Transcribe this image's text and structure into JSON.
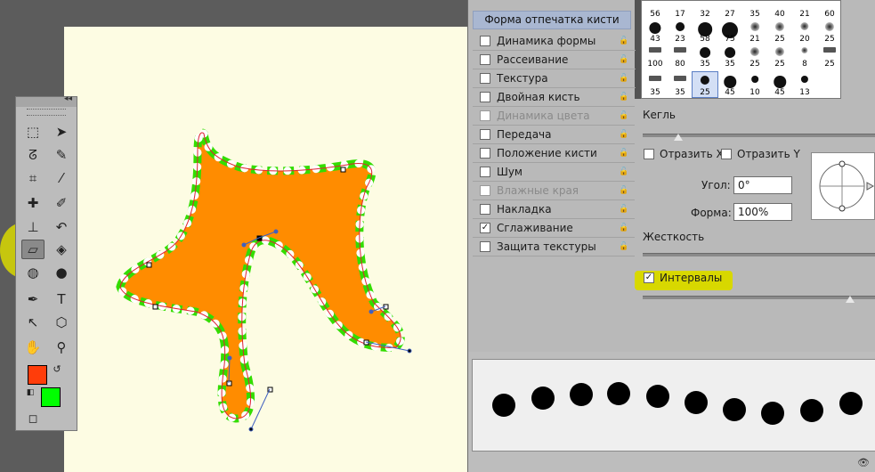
{
  "brush_panel": {
    "title": "Форма отпечатка кисти",
    "options": [
      {
        "label": "Динамика формы",
        "checked": false,
        "enabled": true
      },
      {
        "label": "Рассеивание",
        "checked": false,
        "enabled": true
      },
      {
        "label": "Текстура",
        "checked": false,
        "enabled": true
      },
      {
        "label": "Двойная кисть",
        "checked": false,
        "enabled": true
      },
      {
        "label": "Динамика цвета",
        "checked": false,
        "enabled": false
      },
      {
        "label": "Передача",
        "checked": false,
        "enabled": true
      },
      {
        "label": "Положение кисти",
        "checked": false,
        "enabled": true
      },
      {
        "label": "Шум",
        "checked": false,
        "enabled": true
      },
      {
        "label": "Влажные края",
        "checked": false,
        "enabled": false
      },
      {
        "label": "Накладка",
        "checked": false,
        "enabled": true
      },
      {
        "label": "Сглаживание",
        "checked": true,
        "enabled": true
      },
      {
        "label": "Защита текстуры",
        "checked": false,
        "enabled": true
      }
    ],
    "lock_icon": "lock-icon"
  },
  "presets": {
    "rows": [
      [
        "56",
        "17",
        "32",
        "27",
        "35",
        "40",
        "21",
        "60"
      ],
      [
        "43",
        "23",
        "58",
        "75",
        "21",
        "25",
        "20",
        "25"
      ],
      [
        "100",
        "80",
        "35",
        "35",
        "25",
        "25",
        "8",
        "25"
      ],
      [
        "35",
        "35",
        "25",
        "45",
        "10",
        "45",
        "13"
      ]
    ],
    "selected": {
      "row": 3,
      "col": 2
    }
  },
  "brush_tip": {
    "size_label": "Кегль",
    "flip_x_label": "Отразить X",
    "flip_y_label": "Отразить Y",
    "angle_label": "Угол:",
    "angle_value": "0°",
    "roundness_label": "Форма:",
    "roundness_value": "100%",
    "hardness_label": "Жесткость",
    "spacing_label": "Интервалы",
    "spacing_checked": true,
    "flip_x_checked": false,
    "flip_y_checked": false
  },
  "toolbox": {
    "collapse_glyph": "◂◂",
    "foreground_color": "#ff3d0a",
    "background_color": "#00ff00",
    "tools": [
      "rect-marquee-icon",
      "move-icon",
      "lasso-icon",
      "quick-select-icon",
      "crop-icon",
      "eyedropper-icon",
      "healing-brush-icon",
      "brush-icon",
      "clone-stamp-icon",
      "history-brush-icon",
      "eraser-icon",
      "paint-bucket-icon",
      "blur-icon",
      "dodge-icon",
      "pen-icon",
      "type-icon",
      "path-select-icon",
      "shape-icon",
      "hand-icon",
      "zoom-icon"
    ],
    "active_tool": "eraser-icon"
  },
  "preview_icon": "new-brush-icon",
  "colors": {
    "shape_fill": "#ff8c00",
    "stroke_green": "#33dd00",
    "dot_white": "#ffffff",
    "highlight": "#d8d800",
    "canvas_bg": "#fdfce3"
  }
}
